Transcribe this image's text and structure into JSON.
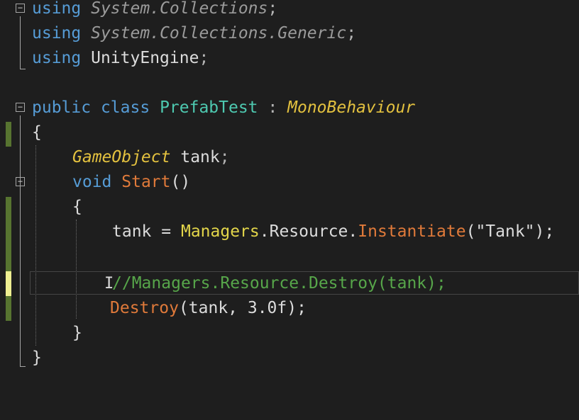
{
  "editor": {
    "lines": [
      {
        "kind": "using",
        "keyword": "using",
        "ns1": "System",
        "dot1": ".",
        "ns2": "Collections",
        "semi": ";"
      },
      {
        "kind": "using",
        "keyword": "using",
        "ns1": "System",
        "dot1": ".",
        "ns2": "Collections",
        "dot2": ".",
        "ns3": "Generic",
        "semi": ";"
      },
      {
        "kind": "using",
        "keyword": "using",
        "ns1": "UnityEngine",
        "semi": ";"
      }
    ],
    "class_decl": {
      "kw_public": "public",
      "kw_class": "class",
      "name": "PrefabTest",
      "colon": ":",
      "base": "MonoBehaviour"
    },
    "brace_open": "{",
    "brace_close": "}",
    "field": {
      "type": "GameObject",
      "name": "tank",
      "semi": ";"
    },
    "method": {
      "kw": "void",
      "name": "Start",
      "parens": "()"
    },
    "inner_brace_open": "{",
    "inner_brace_close": "}",
    "instantiate_line": {
      "target": "tank",
      "op": "=",
      "cls": "Managers",
      "dot1": ".",
      "member": "Resource",
      "dot2": ".",
      "call": "Instantiate",
      "open": "(",
      "arg": "\"Tank\"",
      "close": ");"
    },
    "comment_line": {
      "slashes": "//",
      "cls": "Managers",
      "dot1": ".",
      "member": "Resource",
      "dot2": ".",
      "call": "Destroy",
      "args": "(tank);"
    },
    "destroy_line": {
      "call": "Destroy",
      "args": "(tank, 3.0f);"
    },
    "fold_minus": "−",
    "ibeam_glyph": "I",
    "colors": {
      "background": "#1e1e1e",
      "keyword": "#569cd6",
      "class_name": "#4ec9b0",
      "type_italic": "#e3c13f",
      "method": "#e07a3a",
      "comment": "#57a64a",
      "change_saved": "#577430",
      "change_unsaved": "#efef91"
    }
  }
}
